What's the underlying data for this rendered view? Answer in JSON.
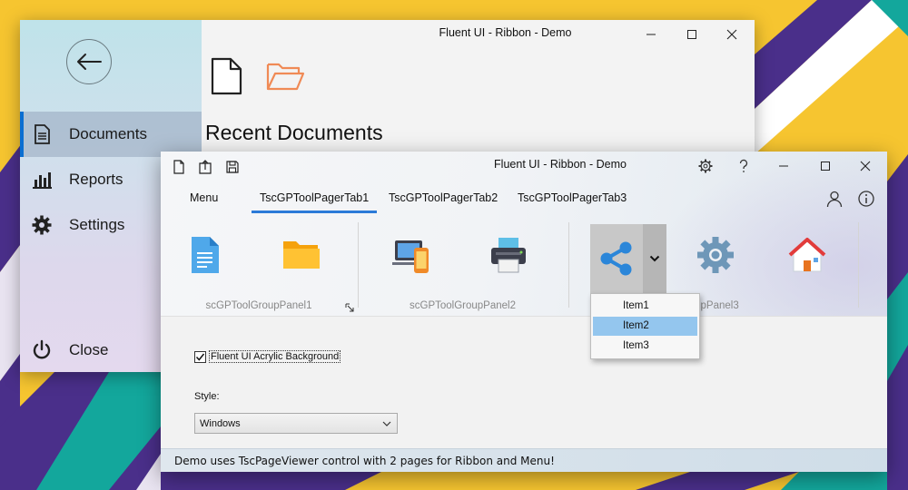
{
  "back_window": {
    "title": "Fluent UI - Ribbon - Demo",
    "nav_items": [
      {
        "label": "Documents",
        "icon": "document-icon",
        "selected": true
      },
      {
        "label": "Reports",
        "icon": "bar-chart-icon",
        "selected": false
      },
      {
        "label": "Settings",
        "icon": "gear-icon",
        "selected": false
      },
      {
        "label": "Close",
        "icon": "power-icon",
        "selected": false
      }
    ],
    "heading": "Recent Documents",
    "icons": [
      "back-arrow-icon",
      "new-document-icon",
      "open-folder-icon"
    ]
  },
  "front_window": {
    "title": "Fluent UI - Ribbon - Demo",
    "quick_access_icons": [
      "new-file-icon",
      "open-file-icon",
      "save-icon"
    ],
    "caption_icons": [
      "settings-icon",
      "help-icon",
      "minimize-icon",
      "maximize-icon",
      "close-icon"
    ],
    "tabs": [
      {
        "label": "Menu",
        "active": false
      },
      {
        "label": "TscGPToolPagerTab1",
        "active": true
      },
      {
        "label": "TscGPToolPagerTab2",
        "active": false
      },
      {
        "label": "TscGPToolPagerTab3",
        "active": false
      }
    ],
    "header_icons": [
      "user-icon",
      "info-icon"
    ],
    "groups": [
      {
        "label": "scGPToolGroupPanel1",
        "buttons": [
          "document-icon",
          "folder-icon"
        ]
      },
      {
        "label": "scGPToolGroupPanel2",
        "buttons": [
          "devices-icon",
          "printer-icon"
        ]
      },
      {
        "label": "scGPToolGroupPanel3",
        "label_visible": "olGroupPanel3",
        "buttons": [
          "share-icon",
          "gear-icon",
          "home-icon"
        ]
      }
    ],
    "checkbox": {
      "label": "Fluent UI Acrylic Background",
      "checked": true
    },
    "style": {
      "label": "Style:",
      "value": "Windows"
    },
    "status_text": "Demo uses TscPageViewer control with 2 pages for Ribbon and Menu!"
  },
  "dropdown": {
    "items": [
      "Item1",
      "Item2",
      "Item3"
    ],
    "highlighted": "Item2"
  },
  "colors": {
    "accent": "#2b7ad8",
    "wallpaper_yellow": "#f6c530",
    "wallpaper_purple": "#4a2f8a",
    "wallpaper_teal": "#13a79c",
    "highlight": "#94c6ee"
  }
}
